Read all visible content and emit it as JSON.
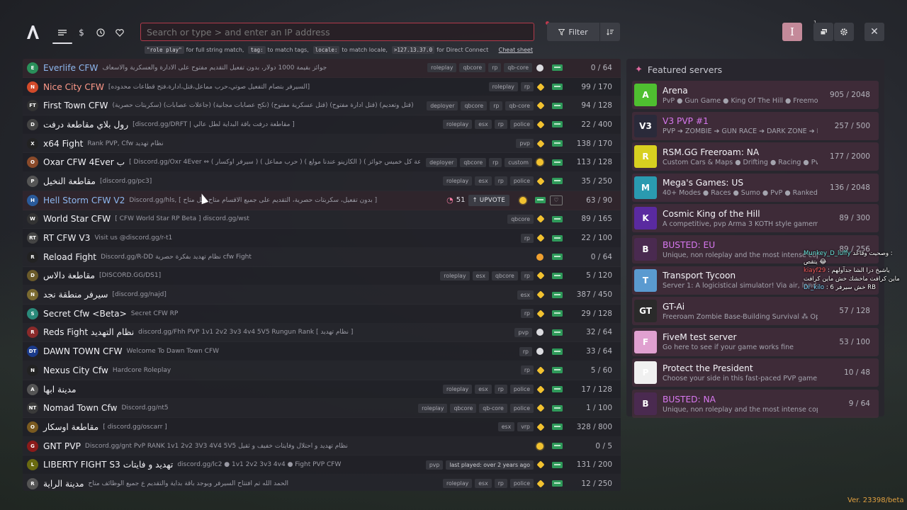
{
  "search": {
    "placeholder": "Search or type > and enter an IP address"
  },
  "hints": {
    "code1": "\"role play\"",
    "text1": "for full string match,",
    "code2": "tag:",
    "text2": "to match tags,",
    "code3": "locale:",
    "text3": "to match locale,",
    "code4": ">127.13.37.0",
    "text4": "for Direct Connect",
    "cheat": "Cheat sheet"
  },
  "toolbar": {
    "filter": "Filter",
    "text_btn": "I",
    "queue_badge": "1"
  },
  "rows": [
    {
      "name": "Everlife CFW",
      "desc": "جوائز بقيمة 1000 دولار، بدون تفعيل التقديم مفتوح على الادارة والعسكرية والاسعاف",
      "tags": [
        "roleplay",
        "qbcore",
        "rp",
        "qb-core"
      ],
      "players": "0 / 64",
      "icon_color": "#2a8f5a",
      "icon_txt": "E",
      "st": "white",
      "kind": "premium"
    },
    {
      "name": "Nice City CFW",
      "desc": "[السيرفر بتصام التفعيل صوتي،حرب مماعل،قتل،ادارة،فتح قطاعات محدوده]",
      "tags": [
        "roleplay",
        "rp"
      ],
      "players": "99 / 170",
      "icon_color": "#d24a2a",
      "icon_txt": "N",
      "st": "sun",
      "kind": "red"
    },
    {
      "name": "First Town CFW",
      "desc": "(سكربتات حصرية) (جاعلات عصابات) (نكح عصابات مجانية) (قتل عسكرية مفتوح) (قتل ادارة مفتوح) (قتل وتعديم)",
      "tags": [
        "deployer",
        "qbcore",
        "rp",
        "qb-core"
      ],
      "players": "94 / 128",
      "icon_color": "#333",
      "icon_txt": "FT",
      "st": "sun",
      "kind": ""
    },
    {
      "name": "رول بلاي مقاطعة درفت",
      "desc": "[discord.gg/DRFT | مقاطعة درفت باقة البداية لطل عالي ]",
      "tags": [
        "roleplay",
        "esx",
        "rp",
        "police"
      ],
      "players": "22 / 400",
      "icon_color": "#444",
      "icon_txt": "D",
      "st": "sun",
      "kind": ""
    },
    {
      "name": "x64 Fight",
      "desc": "Rank PVP, Cfw نظام تهديد",
      "tags": [
        "pvp"
      ],
      "players": "138 / 170",
      "icon_color": "#222",
      "icon_txt": "X",
      "st": "sun",
      "kind": ""
    },
    {
      "name": "Oxar CFW 4Ever ب",
      "desc": "[ Discord.gg/Oxr 4Ever ⇔ ( سيرفر أوكسار ) ( حرب مماعل ) ( الكازينو عندنا مولع ) ( 24 ساعة كل خميس جوائز",
      "tags": [
        "deployer",
        "qbcore",
        "rp",
        "custom"
      ],
      "players": "113 / 128",
      "icon_color": "#8a4a2a",
      "icon_txt": "O",
      "st": "yellow",
      "kind": ""
    },
    {
      "name": "مقاطعة النخيل",
      "desc": "[discord.gg/pc3]",
      "tags": [
        "roleplay",
        "esx",
        "rp",
        "police"
      ],
      "players": "35 / 250",
      "icon_color": "#555",
      "icon_txt": "P",
      "st": "sun",
      "kind": ""
    },
    {
      "name": "Hell Storm CFW V2",
      "desc": "Discord.gg/hls, [ بدون تفعيل، سكربتات حصرية، التقديم على جميع الاقسام متاح قتل متاح ]",
      "tags": [],
      "players": "63 / 90",
      "icon_color": "#2a5a9a",
      "icon_txt": "H",
      "st": "yellow",
      "kind": "premium",
      "upvote": {
        "count": "51",
        "label": "UPVOTE"
      }
    },
    {
      "name": "World Star CFW",
      "desc": "[ CFW World Star RP Beta ] discord.gg/wst",
      "tags": [
        "qbcore"
      ],
      "players": "89 / 165",
      "icon_color": "#333",
      "icon_txt": "W",
      "st": "sun",
      "kind": ""
    },
    {
      "name": "RT CFW V3",
      "desc": "Visit us @discord.gg/r-t1",
      "tags": [
        "rp"
      ],
      "players": "22 / 100",
      "icon_color": "#444",
      "icon_txt": "RT",
      "st": "sun",
      "kind": ""
    },
    {
      "name": "Reload Fight",
      "desc": "Discord.gg/R-DD نظام تهديد بفكرة حصرية cfw Fight",
      "tags": [],
      "players": "0 / 64",
      "icon_color": "#222",
      "icon_txt": "R",
      "st": "orange",
      "kind": ""
    },
    {
      "name": "مقاطعة دالاس",
      "desc": "[DISCORD.GG/DS1]",
      "tags": [
        "roleplay",
        "esx",
        "qbcore",
        "rp"
      ],
      "players": "5 / 120",
      "icon_color": "#6a5a2a",
      "icon_txt": "D",
      "st": "sun",
      "kind": ""
    },
    {
      "name": "سيرفر منطقة نجد",
      "desc": "[discord.gg/najd]",
      "tags": [
        "esx"
      ],
      "players": "387 / 450",
      "icon_color": "#7a6a30",
      "icon_txt": "N",
      "st": "sun",
      "kind": ""
    },
    {
      "name": "Secret Cfw <Beta>",
      "desc": "Secret CFW RP",
      "tags": [
        "rp"
      ],
      "players": "29 / 128",
      "icon_color": "#2a8a7a",
      "icon_txt": "S",
      "st": "sun",
      "kind": ""
    },
    {
      "name": "Reds Fight نظام التهديد",
      "desc": "discord.gg/Fhh PVP 1v1 2v2 3v3 4v4 5V5 Rungun Rank [ نظام تهديد ]",
      "tags": [
        "pvp"
      ],
      "players": "32 / 64",
      "icon_color": "#8a2a2a",
      "icon_txt": "R",
      "st": "white",
      "kind": ""
    },
    {
      "name": "DAWN TOWN CFW",
      "desc": "Welcome To Dawn Town CFW",
      "tags": [
        "rp"
      ],
      "players": "33 / 64",
      "icon_color": "#1a3a8a",
      "icon_txt": "DT",
      "st": "white",
      "kind": ""
    },
    {
      "name": "Nexus City Cfw",
      "desc": "Hardcore Roleplay",
      "tags": [
        "rp"
      ],
      "players": "5 / 60",
      "icon_color": "#222",
      "icon_txt": "N",
      "st": "sun",
      "kind": ""
    },
    {
      "name": "مدينة ابها",
      "desc": "",
      "tags": [
        "roleplay",
        "esx",
        "rp",
        "police"
      ],
      "players": "17 / 128",
      "icon_color": "#555",
      "icon_txt": "A",
      "st": "sun",
      "kind": ""
    },
    {
      "name": "Nomad Town Cfw",
      "desc": "Discord.gg/nt5",
      "tags": [
        "roleplay",
        "qbcore",
        "qb-core",
        "police"
      ],
      "players": "1 / 100",
      "icon_color": "#3a3a3a",
      "icon_txt": "NT",
      "st": "sun",
      "kind": ""
    },
    {
      "name": "مقاطعة اوسكار",
      "desc": "[ discord.gg/oscarr ]",
      "tags": [
        "esx",
        "vrp"
      ],
      "players": "328 / 800",
      "icon_color": "#7a5a20",
      "icon_txt": "O",
      "st": "sun",
      "kind": ""
    },
    {
      "name": "GNT PVP",
      "desc": "Discord.gg/gnt PvP RANK 1v1 2v2 3V3 4V4 5V5 نظام تهديد و احتلال وفايتات خفيف و ثقيل",
      "tags": [],
      "players": "0 / 5",
      "icon_color": "#8a1a1a",
      "icon_txt": "G",
      "st": "yellow",
      "kind": ""
    },
    {
      "name": "LIBERTY FIGHT S3 تهديد و فايتات",
      "desc": "discord.gg/lc2 ● 1v1 2v2 3v3 4v4 ● Fight PVP CFW",
      "tags": [
        "pvp"
      ],
      "lastplayed": "last played: over 2 years ago",
      "players": "131 / 200",
      "icon_color": "#6a6a10",
      "icon_txt": "L",
      "st": "sun",
      "kind": ""
    },
    {
      "name": "مدينة الراية",
      "desc": "الحمد الله تم افتتاح السيرفر ويوجد باقة بداية والتقديم ع جميع الوظائف متاح",
      "tags": [
        "roleplay",
        "esx",
        "rp",
        "police"
      ],
      "players": "12 / 250",
      "icon_color": "#555",
      "icon_txt": "R",
      "st": "sun",
      "kind": ""
    }
  ],
  "featured": {
    "title": "Featured servers",
    "items": [
      {
        "name": "Arena",
        "desc": "PvP ● Gun Game ● King Of The Hill ● Freemode",
        "players": "905 / 2048",
        "icon_color": "#4fbf30",
        "icon_txt": "A"
      },
      {
        "name": "V3 PVP #1",
        "desc": "PVP ➔ ZOMBIE ➔ GUN RACE ➔ DARK ZONE ➔ F",
        "players": "257 / 500",
        "icon_color": "#2a2a3a",
        "icon_txt": "V3",
        "name_color": "#d878f0"
      },
      {
        "name": "RSM.GG Freeroam: NA",
        "desc": "Custom Cars & Maps ● Drifting ● Racing ● PvP ●",
        "players": "177 / 2000",
        "icon_color": "#d8d020",
        "icon_txt": "R"
      },
      {
        "name": "Mega's Games: US",
        "desc": "40+ Modes ● Races ● Sumo ● PvP ● Ranked E",
        "players": "136 / 2048",
        "icon_color": "#2a9ab0",
        "icon_txt": "M"
      },
      {
        "name": "Cosmic King of the Hill",
        "desc": "A competitive, pvp Arma 3 KOTH style gamemode",
        "players": "89 / 300",
        "icon_color": "#5a2aa0",
        "icon_txt": "K"
      },
      {
        "name": "BUSTED: EU",
        "desc": "Unique, non roleplay and the most intense cops vs",
        "players": "89 / 256",
        "icon_color": "#4a2a50",
        "icon_txt": "B",
        "name_color": "#d878f0"
      },
      {
        "name": "Transport Tycoon",
        "desc": "Server 1: A logicistical simulator! Via air, land and sea",
        "players": "",
        "icon_color": "#5a9ad0",
        "icon_txt": "T"
      },
      {
        "name": "GT-Ai",
        "desc": "Freeroam Zombie Base-Building Survival ⁂ Optin",
        "players": "57 / 128",
        "icon_color": "#2a2a2a",
        "icon_txt": "GT"
      },
      {
        "name": "FiveM test server",
        "desc": "Go here to see if your game works fine",
        "players": "53 / 100",
        "icon_color": "#e0a0d0",
        "icon_txt": "F"
      },
      {
        "name": "Protect the President",
        "desc": "Choose your side in this fast-paced PVP gamemode",
        "players": "10 / 48",
        "icon_color": "#f0f0f0",
        "icon_txt": "P"
      },
      {
        "name": "BUSTED: NA",
        "desc": "Unique, non roleplay and the most intense cops vs r",
        "players": "9 / 64",
        "icon_color": "#4a2a50",
        "icon_txt": "B",
        "name_color": "#d878f0"
      }
    ]
  },
  "chat": [
    {
      "user": "Munkey_D_luffy",
      "msg": "وصحيت وقاعد :"
    },
    {
      "user": "",
      "msg": "يتقص 😂"
    },
    {
      "user": "kiayf29",
      "msg": ": ياشيخ درا الشا جدآولهم"
    },
    {
      "user": "",
      "msg": "ماين كرافت ماخشك خش ماين كرافت"
    },
    {
      "user": "Dr_kilo",
      "msg": ": 6 خش سيرفر RB"
    }
  ],
  "version": "Ver. 23398/beta"
}
